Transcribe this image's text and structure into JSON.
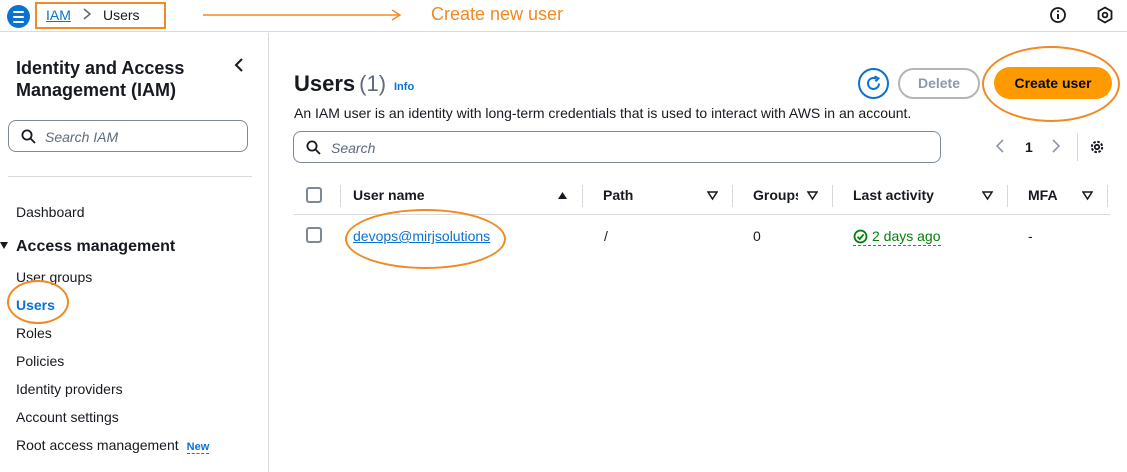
{
  "topbar": {
    "breadcrumb": [
      "IAM",
      "Users"
    ],
    "annotation": "Create new user"
  },
  "sidebar": {
    "title": "Identity and Access Management (IAM)",
    "search_placeholder": "Search IAM",
    "dashboard": "Dashboard",
    "section": "Access management",
    "items": [
      {
        "label": "User groups"
      },
      {
        "label": "Users",
        "active": true
      },
      {
        "label": "Roles"
      },
      {
        "label": "Policies"
      },
      {
        "label": "Identity providers"
      },
      {
        "label": "Account settings"
      },
      {
        "label": "Root access management",
        "badge": "New"
      }
    ]
  },
  "main": {
    "title": "Users",
    "count": "(1)",
    "info": "Info",
    "description": "An IAM user is an identity with long-term credentials that is used to interact with AWS in an account.",
    "delete_label": "Delete",
    "create_label": "Create user",
    "search_placeholder": "Search",
    "page": "1",
    "columns": [
      "User name",
      "Path",
      "Groups",
      "Last activity",
      "MFA"
    ],
    "rows": [
      {
        "user_name": "devops@mirjsolutions",
        "path": "/",
        "groups": "0",
        "last_activity": "2 days ago",
        "mfa": "-"
      }
    ]
  },
  "colors": {
    "accent": "#0972d3",
    "primary_button": "#ff9900",
    "annotation": "#f08a24",
    "success": "#037f0c"
  }
}
